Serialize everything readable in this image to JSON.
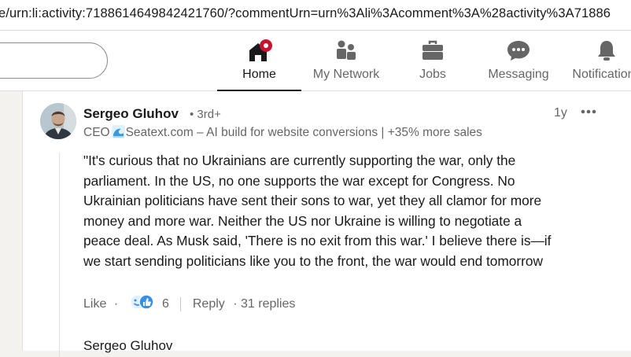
{
  "browser": {
    "url": "e/urn:li:activity:7188614649842421760/?commentUrn=urn%3Ali%3Acomment%3A%28activity%3A71886"
  },
  "nav": {
    "items": [
      {
        "label": "Home",
        "icon": "home-icon",
        "active": true
      },
      {
        "label": "My Network",
        "icon": "network-icon",
        "active": false
      },
      {
        "label": "Jobs",
        "icon": "briefcase-icon",
        "active": false
      },
      {
        "label": "Messaging",
        "icon": "chat-icon",
        "active": false
      },
      {
        "label": "Notifications",
        "icon": "bell-icon",
        "active": false
      }
    ],
    "accent_color": "#cb112d"
  },
  "comment": {
    "author": "Sergeo Gluhov",
    "degree": "• 3rd+",
    "headline_prefix": "CEO",
    "headline_rest": "Seatext.com – AI build for website conversions | +35% more sales",
    "time": "1y",
    "more_label": "•••",
    "lines": [
      "\"It's curious that no Ukrainians are currently supporting the war, only the",
      "parliament. In the US, no one supports the war except for Congress. No",
      "Ukrainian politicians have sent their sons to war, yet they all clamor for more",
      "money and more war. Neither the US nor Ukraine is willing to negotiate a",
      "peace deal. As Musk said, 'There is no exit from this war.' I believe there is—if",
      "we start sending politicians like you to the front, the war would end tomorrow"
    ],
    "like_label": "Like",
    "dot": "·",
    "reaction_count": "6",
    "reply_label": "Reply",
    "replies": "· 31 replies"
  },
  "next": {
    "partial_text": "Sergeo Gluhov"
  }
}
